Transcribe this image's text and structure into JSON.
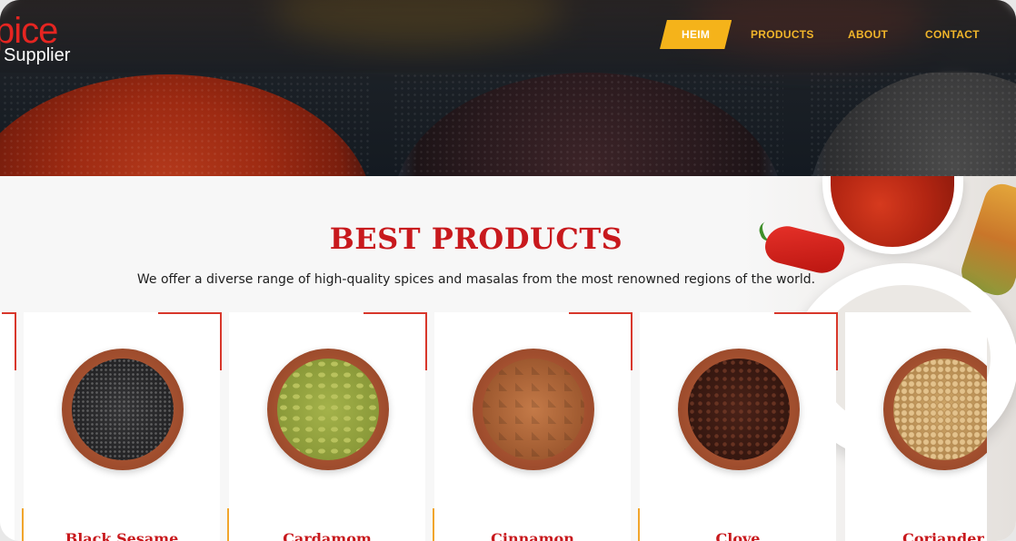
{
  "brand": {
    "logo_main": "pice",
    "logo_sub": "Supplier"
  },
  "nav": {
    "items": [
      {
        "label": "HEIM",
        "active": true
      },
      {
        "label": "PRODUCTS",
        "active": false
      },
      {
        "label": "ABOUT",
        "active": false
      },
      {
        "label": "CONTACT",
        "active": false
      }
    ]
  },
  "products_section": {
    "title": "BEST PRODUCTS",
    "subtitle": "We offer a diverse range of high-quality spices and masalas from the most renowned regions of the world.",
    "products": [
      {
        "name": "Black Sesame",
        "icon": "black-sesame-bowl"
      },
      {
        "name": "Cardamom",
        "icon": "cardamom-bowl"
      },
      {
        "name": "Cinnamon",
        "icon": "cinnamon-bowl"
      },
      {
        "name": "Clove",
        "icon": "clove-bowl"
      },
      {
        "name": "Coriander",
        "icon": "coriander-bowl"
      }
    ]
  },
  "colors": {
    "accent_red": "#c8191d",
    "nav_gold": "#f0b52a",
    "active_nav_bg": "#f5b31a"
  }
}
